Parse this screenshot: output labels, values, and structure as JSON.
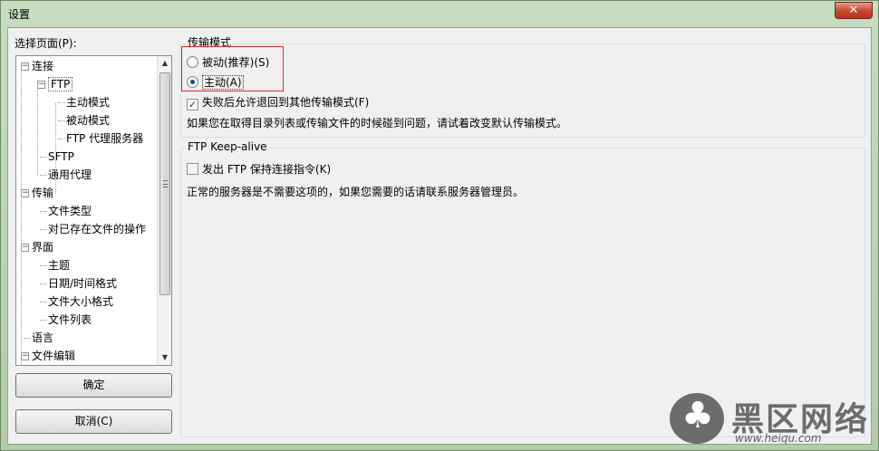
{
  "window": {
    "title": "设置",
    "close_label": "✕"
  },
  "select_page_label": "选择页面(P):",
  "tree": [
    {
      "label": "连接",
      "level": 0,
      "expanded": true
    },
    {
      "label": "FTP",
      "level": 1,
      "expanded": true
    },
    {
      "label": "主动模式",
      "level": 2
    },
    {
      "label": "被动模式",
      "level": 2
    },
    {
      "label": "FTP 代理服务器",
      "level": 2
    },
    {
      "label": "SFTP",
      "level": 1
    },
    {
      "label": "通用代理",
      "level": 1
    },
    {
      "label": "传输",
      "level": 0,
      "expanded": true
    },
    {
      "label": "文件类型",
      "level": 1
    },
    {
      "label": "对已存在文件的操作",
      "level": 1
    },
    {
      "label": "界面",
      "level": 0,
      "expanded": true
    },
    {
      "label": "主题",
      "level": 1
    },
    {
      "label": "日期/时间格式",
      "level": 1
    },
    {
      "label": "文件大小格式",
      "level": 1
    },
    {
      "label": "文件列表",
      "level": 1
    },
    {
      "label": "语言",
      "level": 0
    },
    {
      "label": "文件编辑",
      "level": 0,
      "expanded": true
    }
  ],
  "buttons": {
    "ok": "确定",
    "cancel": "取消(C)"
  },
  "transfer_mode": {
    "title": "传输模式",
    "passive_label": "被动(推荐)(S)",
    "active_label": "主动(A)",
    "selected": "active",
    "fallback_label": "失败后允许退回到其他传输模式(F)",
    "fallback_checked": true,
    "info": "如果您在取得目录列表或传输文件的时候碰到问题，请试着改变默认传输模式。"
  },
  "keepalive": {
    "title": "FTP Keep-alive",
    "checkbox_label": "发出 FTP 保持连接指令(K)",
    "checked": false,
    "info": "正常的服务器是不需要这项的，如果您需要的话请联系服务器管理员。"
  },
  "watermark": {
    "brand": "黑区网络",
    "url": "www.heiqu.com"
  },
  "colors": {
    "highlight": "#d43030",
    "selection_dot": "#1d4a87"
  }
}
